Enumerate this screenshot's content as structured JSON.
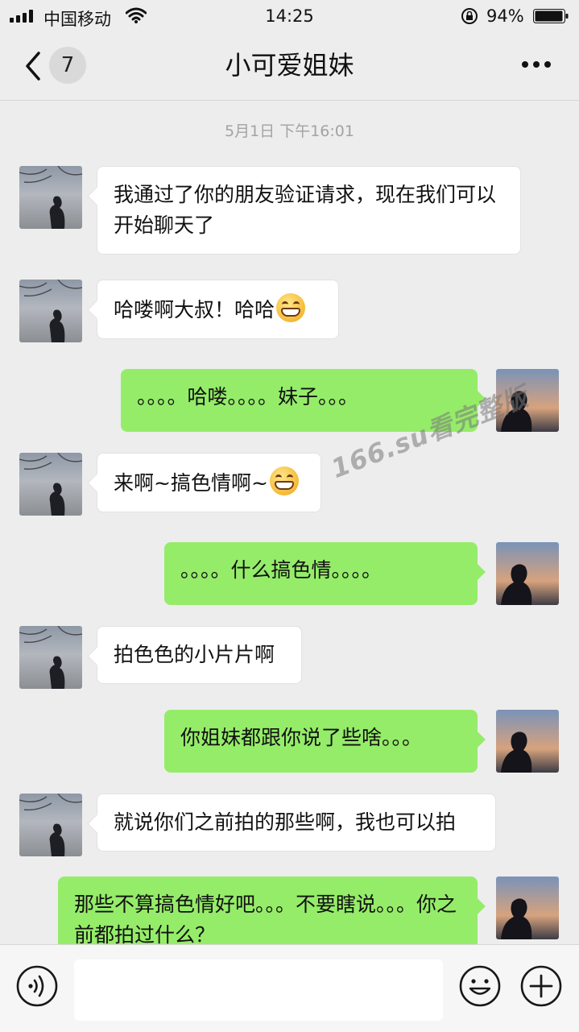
{
  "status_bar": {
    "carrier": "中国移动",
    "time": "14:25",
    "battery": "94%"
  },
  "nav": {
    "unread_count": "7",
    "title": "小可爱姐妹"
  },
  "timestamp": "5月1日 下午16:01",
  "messages": [
    {
      "from": "her",
      "text": "我通过了你的朋友验证请求，现在我们可以开始聊天了"
    },
    {
      "from": "her",
      "text": "哈喽啊大叔！哈哈",
      "emoji": "grin-emoji"
    },
    {
      "from": "me",
      "text": "。。。。哈喽。。。。妹子。。。"
    },
    {
      "from": "her",
      "text": "来啊~搞色情啊~",
      "emoji": "grin-emoji"
    },
    {
      "from": "me",
      "text": "。。。。什么搞色情。。。。"
    },
    {
      "from": "her",
      "text": "拍色色的小片片啊"
    },
    {
      "from": "me",
      "text": "你姐妹都跟你说了些啥。。。"
    },
    {
      "from": "her",
      "text": "就说你们之前拍的那些啊，我也可以拍"
    },
    {
      "from": "me",
      "text": "那些不算搞色情好吧。。。不要瞎说。。。你之前都拍过什么？"
    }
  ],
  "watermark": "166.su看完整版",
  "input": {
    "value": ""
  },
  "colors": {
    "background": "#ededed",
    "outgoing_bubble": "#95ec69",
    "incoming_bubble": "#ffffff"
  }
}
